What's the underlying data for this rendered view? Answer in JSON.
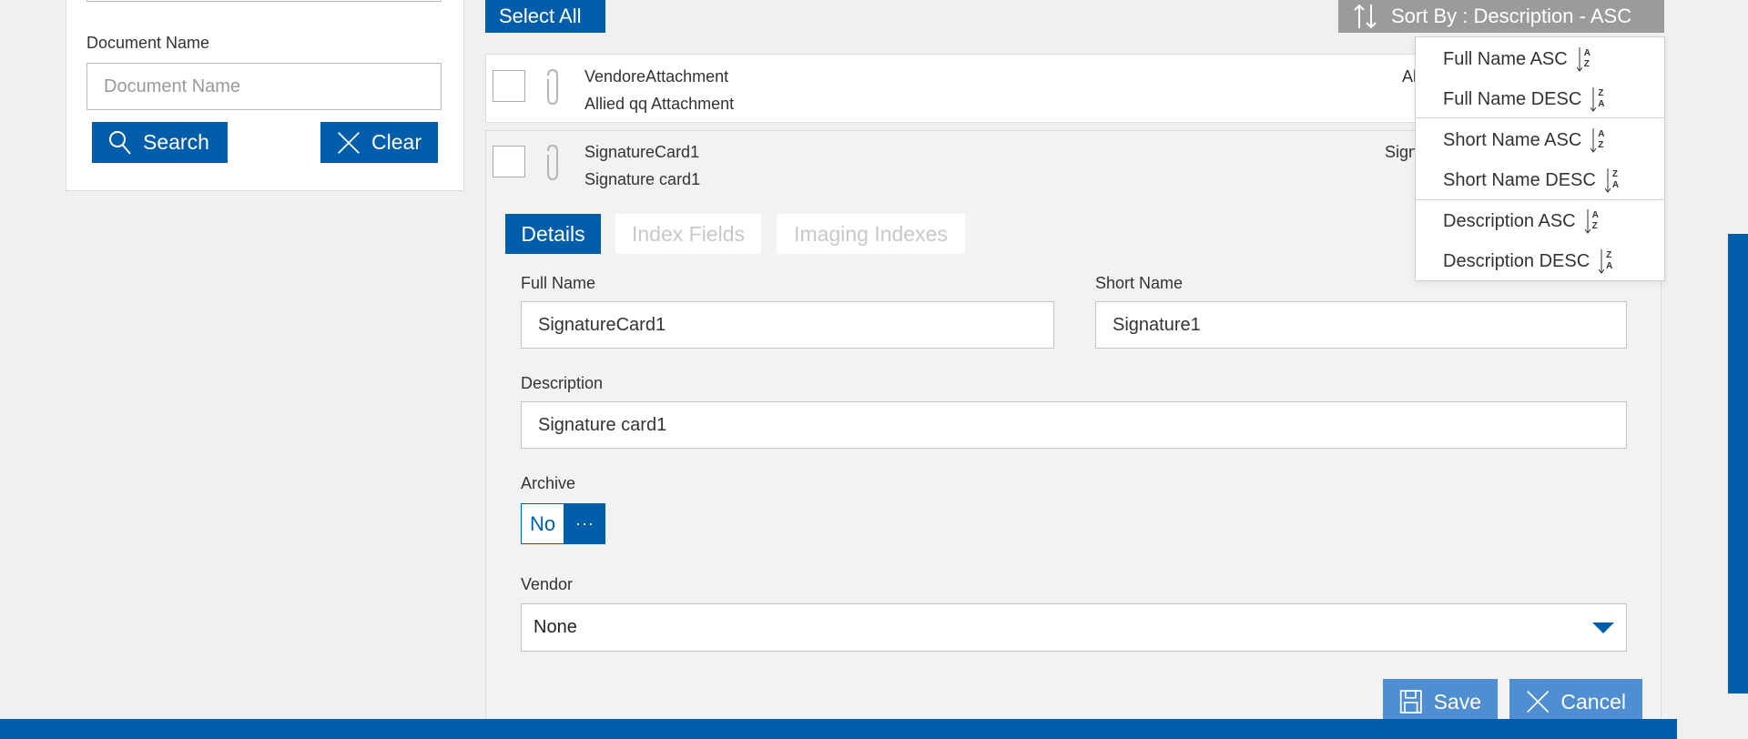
{
  "filter": {
    "document_name_label": "Document Name",
    "document_name_placeholder": "Document Name",
    "search_label": "Search",
    "clear_label": "Clear"
  },
  "toolbar": {
    "select_all_label": "Select All",
    "sort_label": "Sort By : Description - ASC"
  },
  "sort_menu": {
    "items": [
      {
        "label": "Full Name ASC",
        "order": [
          "A",
          "Z"
        ]
      },
      {
        "label": "Full Name DESC",
        "order": [
          "Z",
          "A"
        ]
      },
      {
        "label": "Short Name ASC",
        "order": [
          "A",
          "Z"
        ]
      },
      {
        "label": "Short Name DESC",
        "order": [
          "Z",
          "A"
        ]
      },
      {
        "label": "Description ASC",
        "order": [
          "A",
          "Z"
        ]
      },
      {
        "label": "Description DESC",
        "order": [
          "Z",
          "A"
        ]
      }
    ]
  },
  "documents": [
    {
      "title": "VendoreAttachment",
      "subtitle": "Allied qq Attachment",
      "right_text": "Al"
    },
    {
      "title": "SignatureCard1",
      "subtitle": "Signature card1",
      "right_text": "Sign"
    }
  ],
  "detail": {
    "tabs": [
      {
        "label": "Details",
        "active": true
      },
      {
        "label": "Index Fields",
        "active": false
      },
      {
        "label": "Imaging Indexes",
        "active": false
      }
    ],
    "full_name_label": "Full Name",
    "full_name_value": "SignatureCard1",
    "short_name_label": "Short Name",
    "short_name_value": "Signature1",
    "description_label": "Description",
    "description_value": "Signature card1",
    "archive_label": "Archive",
    "archive_value": "No",
    "archive_more": "···",
    "vendor_label": "Vendor",
    "vendor_value": "None",
    "save_label": "Save",
    "cancel_label": "Cancel"
  },
  "colors": {
    "primary": "#005daa",
    "primary_light": "#4f8fd1",
    "sort_button_bg": "#9b9b9b",
    "inactive_tab_text": "#c8c8c8"
  }
}
